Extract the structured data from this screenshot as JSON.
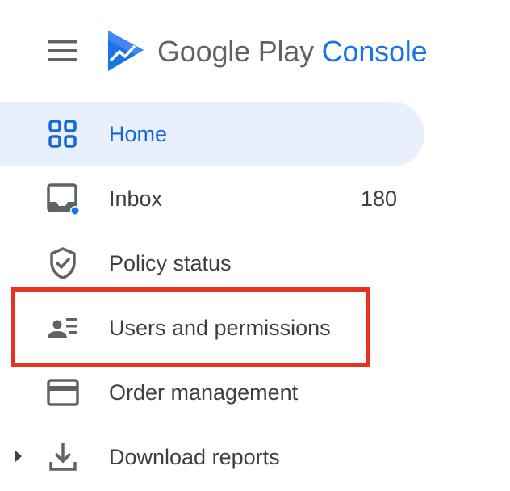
{
  "header": {
    "menu_icon": "hamburger-menu-icon",
    "logo_icon": "google-play-console-logo",
    "brand_main": "Google Play",
    "brand_accent": "Console",
    "brand_accent_color": "#1a73e8",
    "brand_main_color": "#5f6368"
  },
  "nav": {
    "items": [
      {
        "label": "Home",
        "icon": "home-grid-icon",
        "active": true
      },
      {
        "label": "Inbox",
        "icon": "inbox-icon",
        "count": "180",
        "has_notification_dot": true
      },
      {
        "label": "Policy status",
        "icon": "shield-check-icon"
      },
      {
        "label": "Users and permissions",
        "icon": "users-list-icon",
        "highlighted": true
      },
      {
        "label": "Order management",
        "icon": "credit-card-icon"
      },
      {
        "label": "Download reports",
        "icon": "download-icon",
        "expandable": true
      }
    ]
  },
  "colors": {
    "active_bg": "#e8f0fe",
    "active_text": "#1967d2",
    "text": "#3c4043",
    "highlight_border": "#e8321f",
    "notification_dot": "#1a73e8"
  }
}
